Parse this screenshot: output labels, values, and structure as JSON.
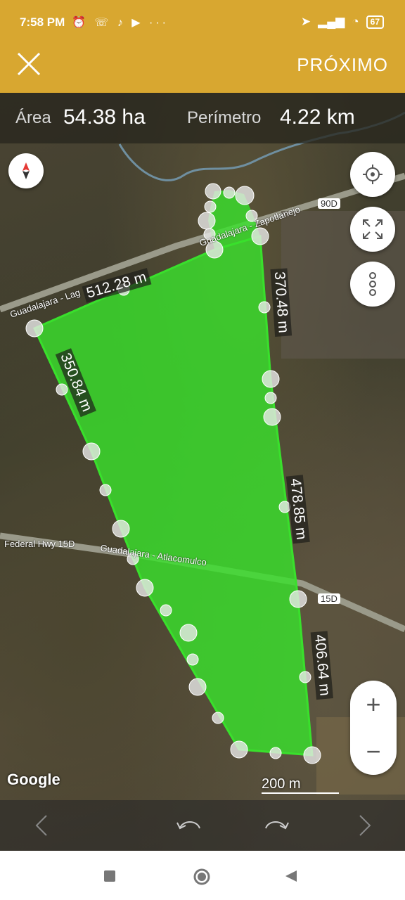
{
  "status": {
    "time": "7:58 PM",
    "battery": "67",
    "extra": "···"
  },
  "toolbar": {
    "next_label": "PRÓXIMO"
  },
  "measure": {
    "area_label": "Área",
    "area_value": "54.38 ha",
    "perimeter_label": "Perímetro",
    "perimeter_value": "4.22 km"
  },
  "segments": [
    "512.28 m",
    "370.48 m",
    "350.84 m",
    "478.85 m",
    "406.64 m"
  ],
  "roads": [
    "Guadalajara - Lag",
    "Guadalajara - Zapotlanejo",
    "Federal Hwy 15D",
    "Guadalajara - Atlacomulco",
    "90D",
    "15D"
  ],
  "map": {
    "attribution": "Google",
    "scale": "200 m"
  },
  "colors": {
    "accent": "#d8a730",
    "polygon": "#39e02c"
  }
}
